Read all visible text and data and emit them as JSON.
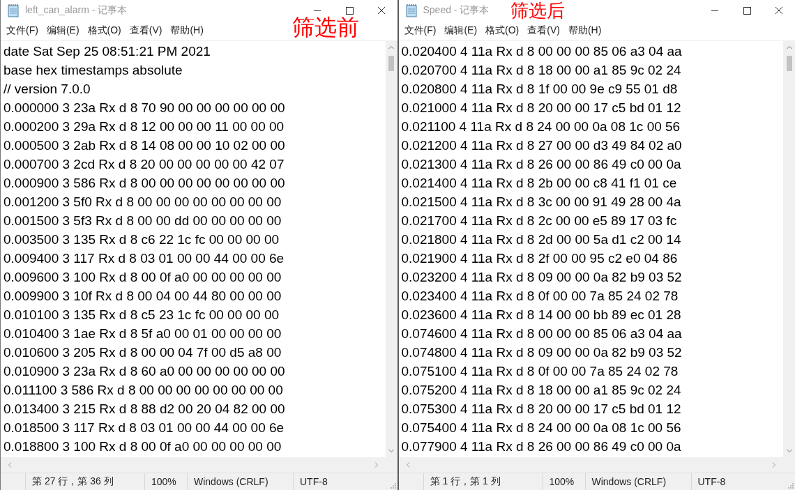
{
  "windows": [
    {
      "title": "left_can_alarm - 记事本",
      "annotation": "筛选前",
      "menu": [
        "文件(F)",
        "编辑(E)",
        "格式(O)",
        "查看(V)",
        "帮助(H)"
      ],
      "lines": [
        "date Sat Sep 25 08:51:21 PM 2021",
        "base hex timestamps absolute",
        "// version 7.0.0",
        "0.000000 3 23a Rx d 8 70 90 00 00 00 00 00 00",
        "0.000200 3 29a Rx d 8 12 00 00 00 11 00 00 00",
        "0.000500 3 2ab Rx d 8 14 08 00 00 10 02 00 00",
        "0.000700 3 2cd Rx d 8 20 00 00 00 00 00 42 07",
        "0.000900 3 586 Rx d 8 00 00 00 00 00 00 00 00",
        "0.001200 3 5f0 Rx d 8 00 00 00 00 00 00 00 00",
        "0.001500 3 5f3 Rx d 8 00 00 dd 00 00 00 00 00",
        "0.003500 3 135 Rx d 8 c6 22 1c fc 00 00 00 00",
        "0.009400 3 117 Rx d 8 03 01 00 00 44 00 00 6e",
        "0.009600 3 100 Rx d 8 00 0f a0 00 00 00 00 00",
        "0.009900 3 10f Rx d 8 00 04 00 44 80 00 00 00",
        "0.010100 3 135 Rx d 8 c5 23 1c fc 00 00 00 00",
        "0.010400 3 1ae Rx d 8 5f a0 00 01 00 00 00 00",
        "0.010600 3 205 Rx d 8 00 00 04 7f 00 d5 a8 00",
        "0.010900 3 23a Rx d 8 60 a0 00 00 00 00 00 00",
        "0.011100 3 586 Rx d 8 00 00 00 00 00 00 00 00",
        "0.013400 3 215 Rx d 8 88 d2 00 20 04 82 00 00",
        "0.018500 3 117 Rx d 8 03 01 00 00 44 00 00 6e",
        "0.018800 3 100 Rx d 8 00 0f a0 00 00 00 00 00"
      ],
      "status": {
        "position": "第 27 行，第 36 列",
        "zoom": "100%",
        "line_ending": "Windows (CRLF)",
        "encoding": "UTF-8"
      }
    },
    {
      "title": "Speed - 记事本",
      "annotation": "筛选后",
      "menu": [
        "文件(F)",
        "编辑(E)",
        "格式(O)",
        "查看(V)",
        "帮助(H)"
      ],
      "lines": [
        "0.020400 4 11a Rx d 8 00 00 00 85 06 a3 04 aa",
        "0.020700 4 11a Rx d 8 18 00 00 a1 85 9c 02 24",
        "0.020800 4 11a Rx d 8 1f 00 00 9e c9 55 01 d8",
        "0.021000 4 11a Rx d 8 20 00 00 17 c5 bd 01 12",
        "0.021100 4 11a Rx d 8 24 00 00 0a 08 1c 00 56",
        "0.021200 4 11a Rx d 8 27 00 00 d3 49 84 02 a0",
        "0.021300 4 11a Rx d 8 26 00 00 86 49 c0 00 0a",
        "0.021400 4 11a Rx d 8 2b 00 00 c8 41 f1 01 ce",
        "0.021500 4 11a Rx d 8 3c 00 00 91 49 28 00 4a",
        "0.021700 4 11a Rx d 8 2c 00 00 e5 89 17 03 fc",
        "0.021800 4 11a Rx d 8 2d 00 00 5a d1 c2 00 14",
        "0.021900 4 11a Rx d 8 2f 00 00 95 c2 e0 04 86",
        "0.023200 4 11a Rx d 8 09 00 00 0a 82 b9 03 52",
        "0.023400 4 11a Rx d 8 0f 00 00 7a 85 24 02 78",
        "0.023600 4 11a Rx d 8 14 00 00 bb 89 ec 01 28",
        "0.074600 4 11a Rx d 8 00 00 00 85 06 a3 04 aa",
        "0.074800 4 11a Rx d 8 09 00 00 0a 82 b9 03 52",
        "0.075100 4 11a Rx d 8 0f 00 00 7a 85 24 02 78",
        "0.075200 4 11a Rx d 8 18 00 00 a1 85 9c 02 24",
        "0.075300 4 11a Rx d 8 20 00 00 17 c5 bd 01 12",
        "0.075400 4 11a Rx d 8 24 00 00 0a 08 1c 00 56",
        "0.077900 4 11a Rx d 8 26 00 00 86 49 c0 00 0a"
      ],
      "status": {
        "position": "第 1 行，第 1 列",
        "zoom": "100%",
        "line_ending": "Windows (CRLF)",
        "encoding": "UTF-8"
      }
    }
  ]
}
